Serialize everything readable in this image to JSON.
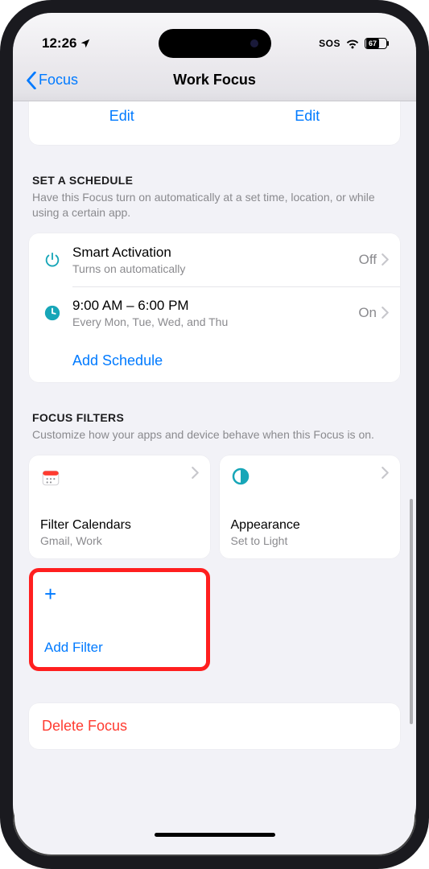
{
  "status": {
    "time": "12:26",
    "sos": "SOS",
    "battery": "67"
  },
  "nav": {
    "back": "Focus",
    "title": "Work Focus"
  },
  "editRow": {
    "left": "Edit",
    "right": "Edit"
  },
  "schedule": {
    "title": "SET A SCHEDULE",
    "desc": "Have this Focus turn on automatically at a set time, location, or while using a certain app.",
    "smart": {
      "title": "Smart Activation",
      "sub": "Turns on automatically",
      "value": "Off"
    },
    "time": {
      "title": "9:00 AM – 6:00 PM",
      "sub": "Every Mon, Tue, Wed, and Thu",
      "value": "On"
    },
    "add": "Add Schedule"
  },
  "filters": {
    "title": "FOCUS FILTERS",
    "desc": "Customize how your apps and device behave when this Focus is on.",
    "calendar": {
      "title": "Filter Calendars",
      "sub": "Gmail, Work"
    },
    "appearance": {
      "title": "Appearance",
      "sub": "Set to Light"
    },
    "add": "Add Filter"
  },
  "delete": "Delete Focus"
}
